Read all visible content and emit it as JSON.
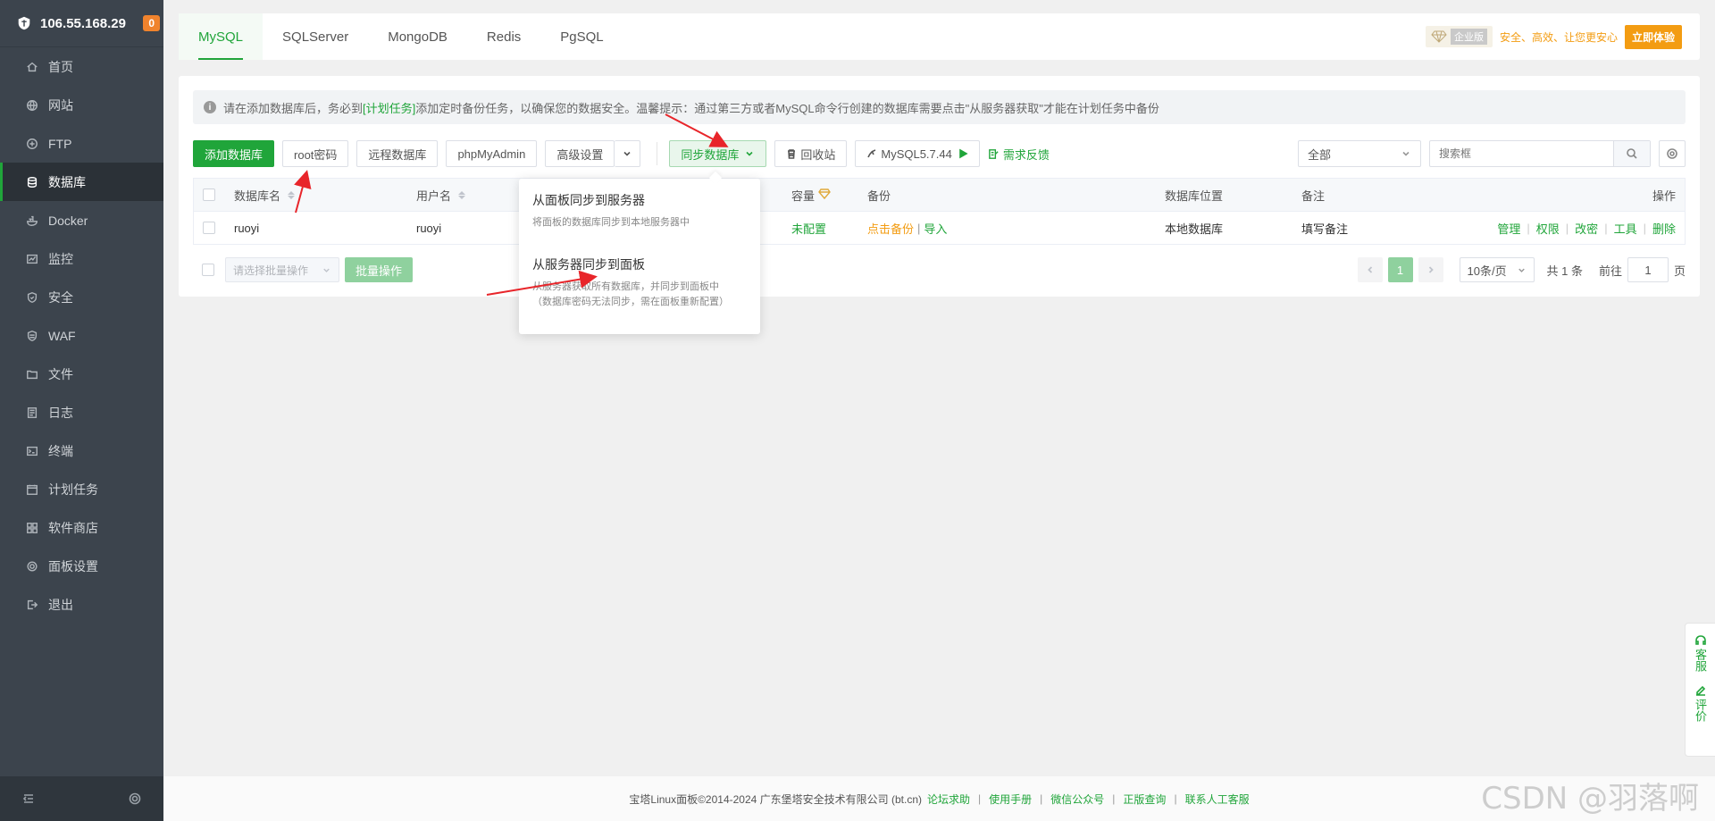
{
  "sidebar": {
    "ip": "106.55.168.29",
    "badge": "0",
    "items": [
      {
        "label": "首页",
        "icon": "home-icon"
      },
      {
        "label": "网站",
        "icon": "globe-icon"
      },
      {
        "label": "FTP",
        "icon": "ftp-icon"
      },
      {
        "label": "数据库",
        "icon": "database-icon",
        "active": true
      },
      {
        "label": "Docker",
        "icon": "docker-icon"
      },
      {
        "label": "监控",
        "icon": "monitor-icon"
      },
      {
        "label": "安全",
        "icon": "shield-icon"
      },
      {
        "label": "WAF",
        "icon": "waf-icon"
      },
      {
        "label": "文件",
        "icon": "folder-icon"
      },
      {
        "label": "日志",
        "icon": "log-icon"
      },
      {
        "label": "终端",
        "icon": "terminal-icon"
      },
      {
        "label": "计划任务",
        "icon": "calendar-icon"
      },
      {
        "label": "软件商店",
        "icon": "apps-icon"
      },
      {
        "label": "面板设置",
        "icon": "settings-icon"
      },
      {
        "label": "退出",
        "icon": "logout-icon"
      }
    ]
  },
  "tabs": [
    "MySQL",
    "SQLServer",
    "MongoDB",
    "Redis",
    "PgSQL"
  ],
  "enterprise": {
    "badge_label": "企业版",
    "slogan": "安全、高效、让您更安心",
    "button": "立即体验"
  },
  "notice": {
    "part1": "请在添加数据库后，务必到",
    "link": "[计划任务]",
    "part2": "添加定时备份任务，以确保您的数据安全。温馨提示：通过第三方或者MySQL命令行创建的数据库需要点击\"从服务器获取\"才能在计划任务中备份"
  },
  "toolbar": {
    "add_db": "添加数据库",
    "root_pwd": "root密码",
    "remote_db": "远程数据库",
    "phpmyadmin": "phpMyAdmin",
    "advanced": "高级设置",
    "sync_db": "同步数据库",
    "recycle": "回收站",
    "mysql_version": "MySQL5.7.44",
    "feedback": "需求反馈",
    "filter": "全部",
    "search_placeholder": "搜索框"
  },
  "table": {
    "headers": {
      "name": "数据库名",
      "user": "用户名",
      "capacity": "容量",
      "backup": "备份",
      "position": "数据库位置",
      "remark": "备注",
      "ops": "操作"
    },
    "rows": [
      {
        "name": "ruoyi",
        "user": "ruoyi",
        "capacity": "未配置",
        "backup": "点击备份",
        "import": "导入",
        "position": "本地数据库",
        "remark": "填写备注",
        "ops": [
          "管理",
          "权限",
          "改密",
          "工具",
          "删除"
        ]
      }
    ]
  },
  "bottom": {
    "batch_placeholder": "请选择批量操作",
    "batch_button": "批量操作",
    "page": "1",
    "page_size": "10条/页",
    "total": "共 1 条",
    "goto_label": "前往",
    "goto_value": "1",
    "page_suffix": "页"
  },
  "dropdown": {
    "items": [
      {
        "title": "从面板同步到服务器",
        "desc": "将面板的数据库同步到本地服务器中"
      },
      {
        "title": "从服务器同步到面板",
        "desc": "从服务器获取所有数据库，并同步到面板中",
        "desc2": "（数据库密码无法同步，需在面板重新配置）"
      }
    ]
  },
  "footer": {
    "copyright": "宝塔Linux面板©2014-2024 广东堡塔安全技术有限公司 (bt.cn)",
    "links": [
      "论坛求助",
      "使用手册",
      "微信公众号",
      "正版查询",
      "联系人工客服"
    ]
  },
  "float": {
    "service": "客服",
    "review": "评价"
  },
  "watermark": "CSDN @羽落啊",
  "colors": {
    "accent": "#20a53a",
    "sidebar_bg": "#3c444d",
    "warning": "#f39c12",
    "arrow": "#e8252a"
  }
}
